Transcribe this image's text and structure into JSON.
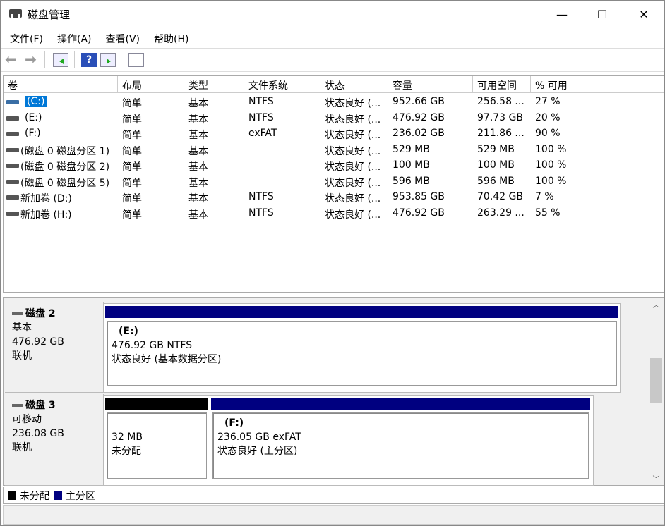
{
  "window": {
    "title": "磁盘管理",
    "minimize": "—",
    "maximize": "☐",
    "close": "✕"
  },
  "menu": [
    "文件(F)",
    "操作(A)",
    "查看(V)",
    "帮助(H)"
  ],
  "columns": [
    "卷",
    "布局",
    "类型",
    "文件系统",
    "状态",
    "容量",
    "可用空间",
    "% 可用"
  ],
  "volumes": [
    [
      "(C:)",
      "简单",
      "基本",
      "NTFS",
      "状态良好 (...",
      "952.66 GB",
      "256.58 ...",
      "27 %"
    ],
    [
      "(E:)",
      "简单",
      "基本",
      "NTFS",
      "状态良好 (...",
      "476.92 GB",
      "97.73 GB",
      "20 %"
    ],
    [
      "(F:)",
      "简单",
      "基本",
      "exFAT",
      "状态良好 (...",
      "236.02 GB",
      "211.86 ...",
      "90 %"
    ],
    [
      "(磁盘 0 磁盘分区 1)",
      "简单",
      "基本",
      "",
      "状态良好 (...",
      "529 MB",
      "529 MB",
      "100 %"
    ],
    [
      "(磁盘 0 磁盘分区 2)",
      "简单",
      "基本",
      "",
      "状态良好 (...",
      "100 MB",
      "100 MB",
      "100 %"
    ],
    [
      "(磁盘 0 磁盘分区 5)",
      "简单",
      "基本",
      "",
      "状态良好 (...",
      "596 MB",
      "596 MB",
      "100 %"
    ],
    [
      "新加卷 (D:)",
      "简单",
      "基本",
      "NTFS",
      "状态良好 (...",
      "953.85 GB",
      "70.42 GB",
      "7 %"
    ],
    [
      "新加卷 (H:)",
      "简单",
      "基本",
      "NTFS",
      "状态良好 (...",
      "476.92 GB",
      "263.29 ...",
      "55 %"
    ]
  ],
  "selected_volume": "(C:)",
  "disks": [
    {
      "name": "磁盘 2",
      "type": "基本",
      "size": "476.92 GB",
      "status": "联机",
      "partitions": [
        {
          "label": "(E:)",
          "info": "476.92 GB NTFS",
          "status": "状态良好 (基本数据分区)",
          "kind": "primary"
        }
      ]
    },
    {
      "name": "磁盘 3",
      "type": "可移动",
      "size": "236.08 GB",
      "status": "联机",
      "partitions": [
        {
          "label": "",
          "info": "32 MB",
          "status": "未分配",
          "kind": "unallocated"
        },
        {
          "label": "(F:)",
          "info": "236.05 GB exFAT",
          "status": "状态良好 (主分区)",
          "kind": "primary"
        }
      ]
    }
  ],
  "legend": [
    {
      "label": "未分配",
      "color": "#000000"
    },
    {
      "label": "主分区",
      "color": "#000080"
    }
  ],
  "colors": {
    "primary": "#000080",
    "unallocated": "#000000",
    "selection": "#0078d7"
  }
}
